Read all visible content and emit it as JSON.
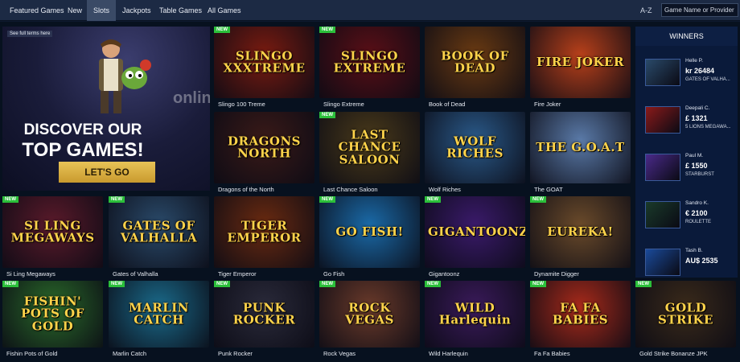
{
  "nav": {
    "tabs": [
      {
        "label": "Featured Games"
      },
      {
        "label": "New"
      },
      {
        "label": "Slots"
      },
      {
        "label": "Jackpots"
      },
      {
        "label": "Table Games"
      },
      {
        "label": "All Games"
      }
    ],
    "active_tab": "Slots",
    "sort_label": "A-Z",
    "search_placeholder": "Game Name or Provider"
  },
  "hero": {
    "terms_label": "See full terms here",
    "headline_line1": "DISCOVER OUR",
    "headline_line2": "TOP GAMES!",
    "cta_label": "LET'S GO"
  },
  "badge_label": "NEW",
  "games": [
    {
      "name": "Slingo 100 Treme",
      "art_text": "SLINGO XXXTREME",
      "new": true,
      "color": "#7a1b10"
    },
    {
      "name": "Slingo Extreme",
      "art_text": "SLINGO EXTREME",
      "new": true,
      "color": "#5a0f16"
    },
    {
      "name": "Book of Dead",
      "art_text": "BOOK OF DEAD",
      "new": false,
      "color": "#6a3a12"
    },
    {
      "name": "Fire Joker",
      "art_text": "FIRE JOKER",
      "new": false,
      "color": "#b8401a"
    },
    {
      "name": "Dragons of the North",
      "art_text": "DRAGONS NORTH",
      "new": false,
      "color": "#3a1a18"
    },
    {
      "name": "Last Chance Saloon",
      "art_text": "LAST CHANCE SALOON",
      "new": true,
      "color": "#4a3a1a"
    },
    {
      "name": "Wolf Riches",
      "art_text": "WOLF RICHES",
      "new": false,
      "color": "#2a5a8a"
    },
    {
      "name": "The GOAT",
      "art_text": "THE G.O.A.T",
      "new": false,
      "color": "#5a7aa8"
    },
    {
      "name": "Si Ling Megaways",
      "art_text": "SI LING MEGAWAYS",
      "new": true,
      "color": "#5a1a2a"
    },
    {
      "name": "Gates of Valhalla",
      "art_text": "GATES OF VALHALLA",
      "new": true,
      "color": "#2a4a6a"
    },
    {
      "name": "Tiger Emperor",
      "art_text": "TIGER EMPEROR",
      "new": false,
      "color": "#6a2a10"
    },
    {
      "name": "Go Fish",
      "art_text": "GO FISH!",
      "new": true,
      "color": "#1a6aa8"
    },
    {
      "name": "Gigantoonz",
      "art_text": "GIGANTOONZ",
      "new": true,
      "color": "#3a1a6a"
    },
    {
      "name": "Dynamite Digger",
      "art_text": "EUREKA!",
      "new": true,
      "color": "#6a4a2a"
    },
    {
      "name": "Fishin Pots of Gold",
      "art_text": "FISHIN' POTS OF GOLD",
      "new": true,
      "color": "#2a6a2a"
    },
    {
      "name": "Marlin Catch",
      "art_text": "MARLIN CATCH",
      "new": true,
      "color": "#1a6a8a"
    },
    {
      "name": "Punk Rocker",
      "art_text": "PUNK ROCKER",
      "new": true,
      "color": "#2a2a3a"
    },
    {
      "name": "Rock Vegas",
      "art_text": "ROCK VEGAS",
      "new": true,
      "color": "#6a3a2a"
    },
    {
      "name": "Wild Harlequin",
      "art_text": "WILD Harlequin",
      "new": true,
      "color": "#3a1a5a"
    },
    {
      "name": "Fa Fa Babies",
      "art_text": "FA FA BABIES",
      "new": true,
      "color": "#a82a1a"
    },
    {
      "name": "Gold Strike Bonanze JPK",
      "art_text": "GOLD STRIKE",
      "new": true,
      "color": "#3a2a1a"
    }
  ],
  "winners": {
    "heading": "WINNERS",
    "items": [
      {
        "name": "Helle P.",
        "amount": "kr 26484",
        "game": "GATES OF VALHA...",
        "color": "#2a4a6a"
      },
      {
        "name": "Deepali C.",
        "amount": "£ 1321",
        "game": "5 LIONS MEGAWA...",
        "color": "#8a1a1a"
      },
      {
        "name": "Paul M.",
        "amount": "£ 1550",
        "game": "STARBURST",
        "color": "#4a2a8a"
      },
      {
        "name": "Sandro K.",
        "amount": "€ 2100",
        "game": "ROULETTE",
        "color": "#1a3a2a"
      },
      {
        "name": "Tash B.",
        "amount": "AU$ 2535",
        "game": "",
        "color": "#1a4a9a"
      }
    ]
  },
  "colors": {
    "nav_bg": "#1c2a44",
    "page_bg": "#07111f",
    "new_badge": "#2bbf3a",
    "cta": "#d4a63a",
    "winners_bg": "#0a1a3a"
  },
  "watermark": "onlineslot"
}
